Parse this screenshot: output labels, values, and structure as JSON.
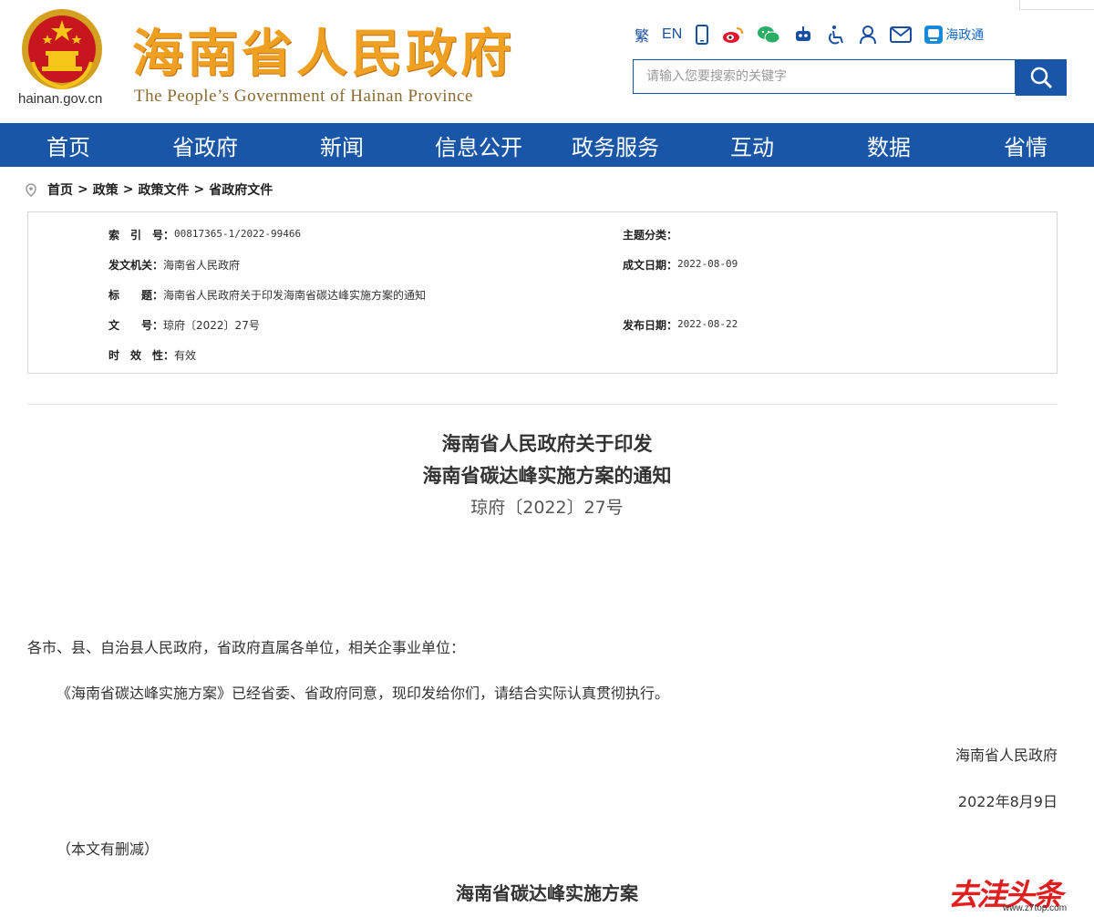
{
  "header": {
    "domain": "hainan.gov.cn",
    "title": "海南省人民政府",
    "subtitle": "The People’s Government  of Hainan Province",
    "tools": {
      "traditional": "繁",
      "english": "EN",
      "haizhengtong": "海政通"
    },
    "search": {
      "placeholder": "请输入您要搜索的关键字"
    }
  },
  "nav": {
    "items": [
      "首页",
      "省政府",
      "新闻",
      "信息公开",
      "政务服务",
      "互动",
      "数据",
      "省情"
    ]
  },
  "breadcrumb": {
    "items": [
      "首页",
      "政策",
      "政策文件",
      "省政府文件"
    ],
    "separator": ">"
  },
  "meta": {
    "index_label": "索　引　号：",
    "index_value": "00817365-1/2022-99466",
    "topic_label": "主题分类：",
    "topic_value": "",
    "issuer_label": "发文机关：",
    "issuer_value": "海南省人民政府",
    "written_label": "成文日期：",
    "written_value": "2022-08-09",
    "title_label": "标　　题：",
    "title_value": "海南省人民政府关于印发海南省碳达峰实施方案的通知",
    "docno_label": "文　　号：",
    "docno_value": "琼府〔2022〕27号",
    "published_label": "发布日期：",
    "published_value": "2022-08-22",
    "validity_label": "时　效　性：",
    "validity_value": "有效"
  },
  "document": {
    "title_line1": "海南省人民政府关于印发",
    "title_line2": "海南省碳达峰实施方案的通知",
    "doc_number": "琼府〔2022〕27号",
    "salutation": "各市、县、自治县人民政府，省政府直属各单位，相关企事业单位：",
    "body": "《海南省碳达峰实施方案》已经省委、省政府同意，现印发给你们，请结合实际认真贯彻执行。",
    "signature": "海南省人民政府",
    "date": "2022年8月9日",
    "note": "（本文有删减）",
    "next_heading": "海南省碳达峰实施方案"
  },
  "watermark": {
    "text": "去洼头条",
    "url": "www.z7top.com"
  },
  "colors": {
    "brand_blue": "#1a56a8",
    "title_orange": "#f0a020",
    "watermark_red": "#e02020"
  }
}
